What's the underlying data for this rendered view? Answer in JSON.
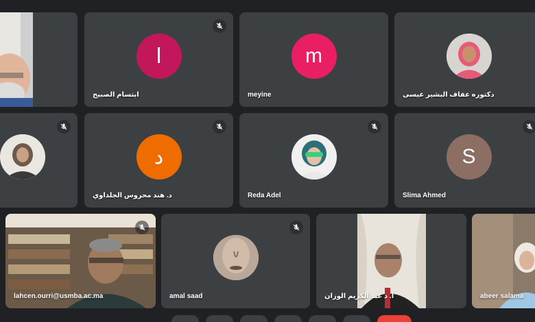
{
  "participants": [
    {
      "name": "",
      "type": "video",
      "muted": false
    },
    {
      "name": "ابتسام الصبيح",
      "initial": "ا",
      "color": "#c2185b",
      "muted": true
    },
    {
      "name": "meyine",
      "initial": "m",
      "color": "#e91e63",
      "muted": false
    },
    {
      "name": "دكتوره عفاف البشير عيسى",
      "type": "photo",
      "muted": false
    },
    {
      "name": "",
      "type": "photo",
      "muted": true
    },
    {
      "name": "د. هند محروس الجلداوي",
      "initial": "د",
      "color": "#ef6c00",
      "muted": true
    },
    {
      "name": "Reda Adel",
      "type": "photo",
      "muted": true
    },
    {
      "name": "Slima Ahmed",
      "initial": "S",
      "color": "#8d6e63",
      "muted": true
    },
    {
      "name": "lahcen.ourri@usmba.ac.ma",
      "type": "video",
      "muted": true
    },
    {
      "name": "amal saad",
      "type": "photo",
      "muted": true
    },
    {
      "name": "أ. د عبد الكريم الوزان",
      "type": "video",
      "muted": false
    },
    {
      "name": "abeer salama",
      "type": "video",
      "muted": false
    }
  ],
  "icons": {
    "mute": "mic-off-icon"
  },
  "colors": {
    "background": "#202124",
    "tile": "#3c4043",
    "end_call": "#ea4335"
  }
}
